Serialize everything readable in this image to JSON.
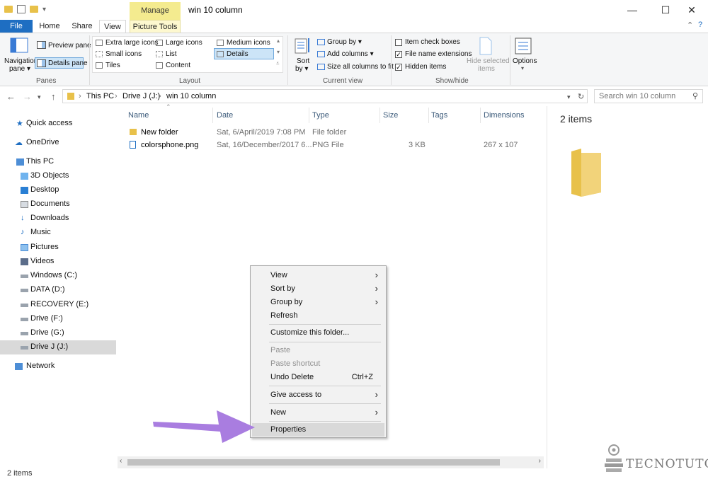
{
  "titlebar": {
    "title": "win 10 column",
    "context_tab": "Manage",
    "minimize": "—",
    "maximize": "☐",
    "close": "✕"
  },
  "tabs": {
    "file": "File",
    "home": "Home",
    "share": "Share",
    "view": "View",
    "picture_tools": "Picture Tools"
  },
  "ribbon": {
    "panes": {
      "label": "Panes",
      "navigation_pane_l1": "Navigation",
      "navigation_pane_l2": "pane ▾",
      "preview_pane": "Preview pane",
      "details_pane": "Details pane"
    },
    "layout": {
      "label": "Layout",
      "extra_large_icons": "Extra large icons",
      "large_icons": "Large icons",
      "medium_icons": "Medium icons",
      "small_icons": "Small icons",
      "list": "List",
      "details": "Details",
      "tiles": "Tiles",
      "content": "Content",
      "selected": "Details"
    },
    "current_view": {
      "label": "Current view",
      "sort_by_l1": "Sort",
      "sort_by_l2": "by ▾",
      "group_by": "Group by ▾",
      "add_columns": "Add columns ▾",
      "size_all_columns": "Size all columns to fit"
    },
    "show_hide": {
      "label": "Show/hide",
      "item_check_boxes": "Item check boxes",
      "item_check_boxes_checked": false,
      "file_name_extensions": "File name extensions",
      "file_name_extensions_checked": true,
      "hidden_items": "Hidden items",
      "hidden_items_checked": true,
      "hide_selected_l1": "Hide selected",
      "hide_selected_l2": "items"
    },
    "options": "Options"
  },
  "address": {
    "crumbs": [
      "This PC",
      "Drive J (J:)",
      "win 10 column"
    ],
    "search_placeholder": "Search win 10 column"
  },
  "nav": {
    "items": [
      {
        "label": "Quick access",
        "icon": "star-icon"
      },
      {
        "label": "OneDrive",
        "icon": "cloud-icon"
      },
      {
        "label": "This PC",
        "icon": "computer-icon"
      },
      {
        "label": "3D Objects",
        "icon": "cube-icon"
      },
      {
        "label": "Desktop",
        "icon": "desktop-icon"
      },
      {
        "label": "Documents",
        "icon": "documents-icon"
      },
      {
        "label": "Downloads",
        "icon": "download-icon"
      },
      {
        "label": "Music",
        "icon": "music-icon"
      },
      {
        "label": "Pictures",
        "icon": "pictures-icon"
      },
      {
        "label": "Videos",
        "icon": "videos-icon"
      },
      {
        "label": "Windows (C:)",
        "icon": "drive-icon"
      },
      {
        "label": "DATA (D:)",
        "icon": "drive-icon"
      },
      {
        "label": "RECOVERY (E:)",
        "icon": "drive-icon"
      },
      {
        "label": "Drive (F:)",
        "icon": "drive-icon"
      },
      {
        "label": "Drive (G:)",
        "icon": "drive-icon"
      },
      {
        "label": "Drive J (J:)",
        "icon": "drive-icon"
      },
      {
        "label": "Network",
        "icon": "network-icon"
      }
    ],
    "selected": "Drive J (J:)"
  },
  "columns": [
    "Name",
    "Date",
    "Type",
    "Size",
    "Tags",
    "Dimensions"
  ],
  "files": [
    {
      "name": "New folder",
      "date": "Sat, 6/April/2019  7:08 PM",
      "type": "File folder",
      "size": "",
      "tags": "",
      "dimensions": ""
    },
    {
      "name": "colorsphone.png",
      "date": "Sat, 16/December/2017  6...",
      "type": "PNG File",
      "size": "3 KB",
      "tags": "",
      "dimensions": "267 x 107"
    }
  ],
  "details_pane": {
    "count": "2 items"
  },
  "context_menu": {
    "view": "View",
    "sort_by": "Sort by",
    "group_by": "Group by",
    "refresh": "Refresh",
    "customize": "Customize this folder...",
    "paste": "Paste",
    "paste_shortcut": "Paste shortcut",
    "undo_delete": "Undo Delete",
    "undo_shortcut": "Ctrl+Z",
    "give_access": "Give access to",
    "new": "New",
    "properties": "Properties"
  },
  "status": {
    "count": "2 items"
  },
  "watermark": "TECNOTUTO",
  "colors": {
    "accent": "#1e6ec2",
    "folder": "#e8c14a",
    "manage_tab": "#f4eb8f",
    "arrow": "#a97de0"
  }
}
